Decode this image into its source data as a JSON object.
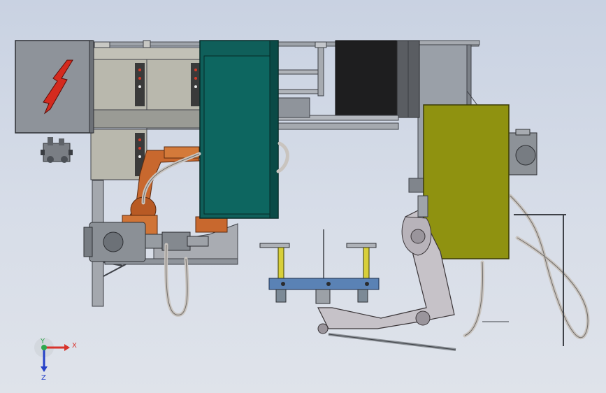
{
  "view": {
    "type": "cad-assembly-viewport",
    "background": [
      "#c9d2e2",
      "#dfe3ea"
    ]
  },
  "triad": {
    "x_label": "X",
    "y_label": "Y",
    "z_label": "Z",
    "x_color": "#d8342c",
    "y_color": "#2fa84f",
    "z_color": "#2540c8"
  },
  "components": {
    "electrical_cabinet": {
      "icon": "lightning-bolt-icon",
      "color": "#8e939a",
      "bolt_color": "#d42a1e"
    },
    "control_panels": {
      "count": 3,
      "color": "#b9b8ad"
    },
    "teal_enclosure": {
      "color": "#0f5f5a"
    },
    "black_unit": {
      "color": "#1e1e1f"
    },
    "yellow_panel": {
      "color": "#8f9210"
    },
    "robot_arm": {
      "color": "#c8682e"
    },
    "blue_fixture_table": {
      "color": "#5a82b5"
    },
    "hoses": {
      "color": "#c9c4bf"
    }
  }
}
